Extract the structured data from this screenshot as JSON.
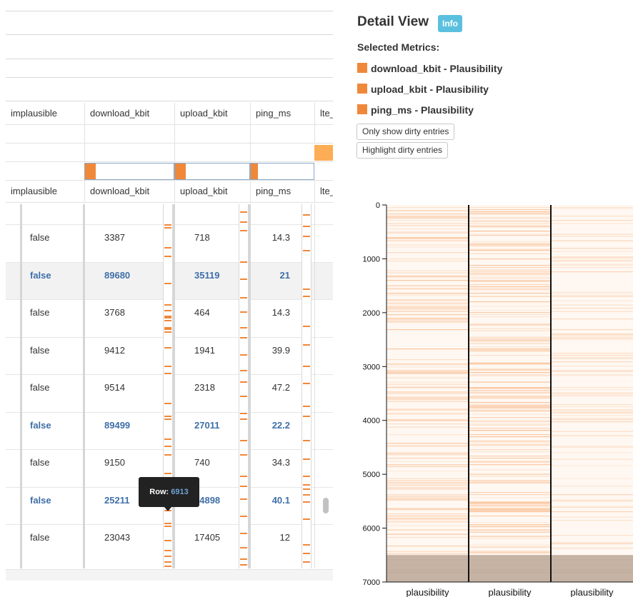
{
  "table": {
    "columns": [
      "implausible",
      "download_kbit",
      "upload_kbit",
      "ping_ms",
      "lte_"
    ],
    "rows": [
      {
        "implausible": "false",
        "download_kbit": "3387",
        "upload_kbit": "718",
        "ping_ms": "14.3",
        "dirty": false,
        "highlighted": false
      },
      {
        "implausible": "false",
        "download_kbit": "89680",
        "upload_kbit": "35119",
        "ping_ms": "21",
        "dirty": true,
        "highlighted": true
      },
      {
        "implausible": "false",
        "download_kbit": "3768",
        "upload_kbit": "464",
        "ping_ms": "14.3",
        "dirty": false,
        "highlighted": false
      },
      {
        "implausible": "false",
        "download_kbit": "9412",
        "upload_kbit": "1941",
        "ping_ms": "39.9",
        "dirty": false,
        "highlighted": false
      },
      {
        "implausible": "false",
        "download_kbit": "9514",
        "upload_kbit": "2318",
        "ping_ms": "47.2",
        "dirty": false,
        "highlighted": false
      },
      {
        "implausible": "false",
        "download_kbit": "89499",
        "upload_kbit": "27011",
        "ping_ms": "22.2",
        "dirty": true,
        "highlighted": false
      },
      {
        "implausible": "false",
        "download_kbit": "9150",
        "upload_kbit": "740",
        "ping_ms": "34.3",
        "dirty": false,
        "highlighted": false
      },
      {
        "implausible": "false",
        "download_kbit": "25211",
        "upload_kbit": "24898",
        "ping_ms": "40.1",
        "dirty": true,
        "highlighted": false
      },
      {
        "implausible": "false",
        "download_kbit": "23043",
        "upload_kbit": "17405",
        "ping_ms": "12",
        "dirty": false,
        "highlighted": false
      }
    ],
    "tooltip": {
      "label": "Row:",
      "value": "6913"
    }
  },
  "detail": {
    "title": "Detail View",
    "info_badge": "Info",
    "selected_title": "Selected Metrics:",
    "metrics": [
      "download_kbit - Plausibility",
      "upload_kbit - Plausibility",
      "ping_ms - Plausibility"
    ],
    "buttons": {
      "only_dirty": "Only show dirty entries",
      "highlight_dirty": "Highlight dirty entries"
    }
  },
  "colors": {
    "accent": "#f0883a",
    "info": "#5bc0de",
    "dirty_text": "#3f6fa8",
    "lte_fill": "#fdad55"
  },
  "chart_data": {
    "type": "heatmap",
    "y_ticks": [
      "0",
      "1000",
      "2000",
      "3000",
      "4000",
      "5000",
      "6000",
      "7000"
    ],
    "ylim": [
      0,
      7000
    ],
    "columns": [
      "plausibility",
      "plausibility",
      "plausibility"
    ],
    "shaded_region_start": 6500
  }
}
